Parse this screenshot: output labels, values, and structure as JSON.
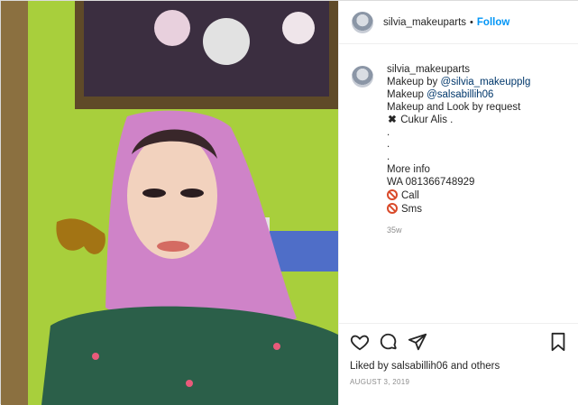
{
  "post": {
    "username": "silvia_makeuparts",
    "follow_label": "Follow",
    "caption_lines": [
      {
        "prefix": "Makeup by ",
        "mention": "@silvia_makeupplg"
      },
      {
        "prefix": "Makeup ",
        "mention": "@salsabillih06"
      },
      {
        "text": "Makeup and Look by request"
      },
      {
        "icon": "cross-mark",
        "text": "Cukur Alis ."
      },
      {
        "text": "."
      },
      {
        "text": "."
      },
      {
        "text": "."
      },
      {
        "text": "More info"
      },
      {
        "text": "WA 081366748929"
      },
      {
        "icon": "no-entry",
        "text": "Call"
      },
      {
        "icon": "no-entry",
        "text": "Sms"
      }
    ],
    "age": "35w",
    "likes_prefix": "Liked by ",
    "likes_user": "salsabillih06",
    "likes_suffix": " and others",
    "date": "AUGUST 3, 2019"
  }
}
